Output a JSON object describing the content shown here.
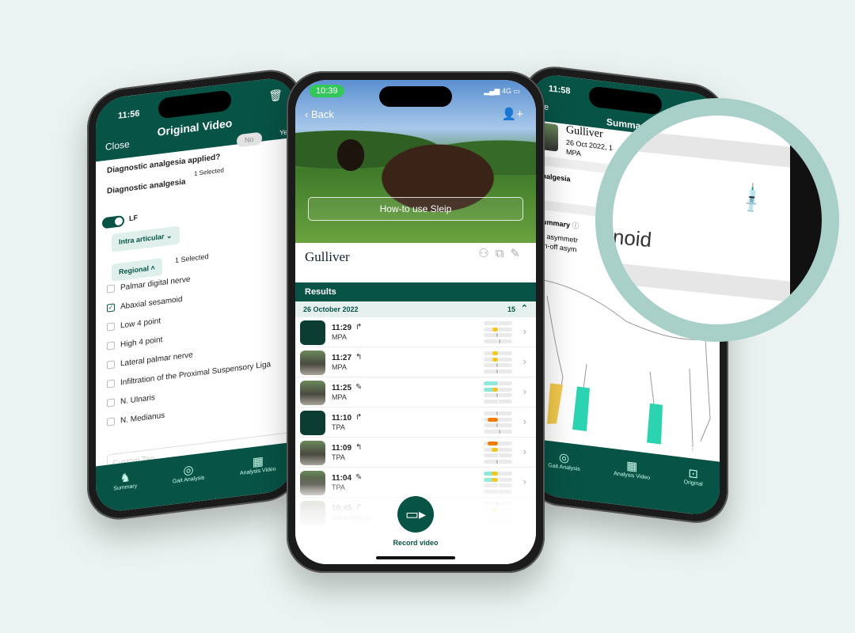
{
  "colors": {
    "brand": "#075346",
    "background": "#eaf3f1",
    "ring": "#a8cfc8",
    "yellow": "#f5c518",
    "orange": "#f57c00",
    "teal": "#8fe8d8",
    "gray": "#bbbbbb"
  },
  "left_phone": {
    "time": "11:56",
    "title": "Original Video",
    "close": "Close",
    "trash_icon": "trash-icon",
    "question": "Diagnostic analgesia applied?",
    "no": "No",
    "yes": "Yes",
    "analgesia_label": "Diagnostic analgesia",
    "analgesia_count": "1 Selected",
    "toggle_label": "LF",
    "toggle_on": true,
    "intra": "Intra articular",
    "regional": "Regional",
    "regional_count": "1 Selected",
    "options": [
      {
        "label": "Palmar digital nerve",
        "checked": false
      },
      {
        "label": "Abaxial sesamoid",
        "checked": true
      },
      {
        "label": "Low 4 point",
        "checked": false
      },
      {
        "label": "High 4 point",
        "checked": false
      },
      {
        "label": "Lateral palmar nerve",
        "checked": false
      },
      {
        "label": "Infiltration of the Proximal Suspensory Liga",
        "checked": false
      },
      {
        "label": "N. Ulnaris",
        "checked": false
      },
      {
        "label": "N. Medianus",
        "checked": false
      }
    ],
    "custom_tag_placeholder": "Custom Tag",
    "tabs": [
      "Summary",
      "Gait Analysis",
      "Analysis Video"
    ]
  },
  "center_phone": {
    "time": "10:39",
    "network": "4G",
    "back": "Back",
    "howto": "How-to use Sleip",
    "horse_name": "Gulliver",
    "results": "Results",
    "date": "26 October 2022",
    "count": "15",
    "rows": [
      {
        "time": "11:29",
        "type": "MPA",
        "icon": "turn-right",
        "thumb": "dark",
        "bars": [
          [
            0,
            0,
            "gray"
          ],
          [
            -0.4,
            0,
            "yellow"
          ],
          [
            -0.1,
            0,
            "gray"
          ],
          [
            0.15,
            0,
            "gray"
          ]
        ]
      },
      {
        "time": "11:27",
        "type": "MPA",
        "icon": "turn-left",
        "thumb": "photo",
        "bars": [
          [
            -0.4,
            0,
            "yellow"
          ],
          [
            -0.4,
            0,
            "yellow"
          ],
          [
            -0.1,
            0,
            "gray"
          ],
          [
            -0.1,
            0,
            "gray"
          ]
        ]
      },
      {
        "time": "11:25",
        "type": "MPA",
        "icon": "syringe",
        "thumb": "photo",
        "bars": [
          [
            -1,
            0,
            "teal"
          ],
          [
            -0.4,
            -1,
            "yellow"
          ],
          [
            -0.1,
            0,
            "gray"
          ],
          [
            0,
            0,
            "gray"
          ]
        ]
      },
      {
        "time": "11:10",
        "type": "TPA",
        "icon": "turn-right",
        "thumb": "dark",
        "bars": [
          [
            -0.1,
            0,
            "gray"
          ],
          [
            -0.7,
            0,
            "orange"
          ],
          [
            -0.1,
            0,
            "gray"
          ],
          [
            0.15,
            0,
            "gray"
          ]
        ]
      },
      {
        "time": "11:09",
        "type": "TPA",
        "icon": "turn-left",
        "thumb": "photo",
        "bars": [
          [
            -0.7,
            0,
            "orange"
          ],
          [
            -0.45,
            0,
            "yellow"
          ],
          [
            0,
            0,
            "gray"
          ],
          [
            -0.1,
            0,
            "gray"
          ]
        ]
      },
      {
        "time": "11:04",
        "type": "TPA",
        "icon": "syringe",
        "thumb": "photo",
        "bars": [
          [
            -0.45,
            -1,
            "yellow"
          ],
          [
            -0.45,
            -1,
            "yellow"
          ],
          [
            0,
            0,
            "gray"
          ],
          [
            0,
            0,
            "gray"
          ]
        ]
      },
      {
        "time": "10:45",
        "type": "Basic trot up",
        "icon": "turn-right",
        "thumb": "faded",
        "bars": [
          [
            -0.1,
            0,
            "gray"
          ],
          [
            -0.4,
            0,
            "yellow"
          ],
          [
            0,
            0,
            "gray"
          ],
          [
            0.1,
            0,
            "gray"
          ]
        ]
      }
    ],
    "record": "Record video"
  },
  "right_phone": {
    "time": "11:58",
    "close": "Close",
    "title": "Summary",
    "horse_name": "Gulliver",
    "date": "26 Oct 2022, 1",
    "type": "MPA",
    "analgesia": "Diagnostic analgesia",
    "summary": "Summary",
    "line1": "Impact asymmetr",
    "line2": "Hind push-off asym",
    "tabs": [
      "Gait Analysis",
      "Analysis Video",
      "Original"
    ]
  },
  "magnifier": {
    "text": "noid",
    "icon": "syringe-icon"
  }
}
